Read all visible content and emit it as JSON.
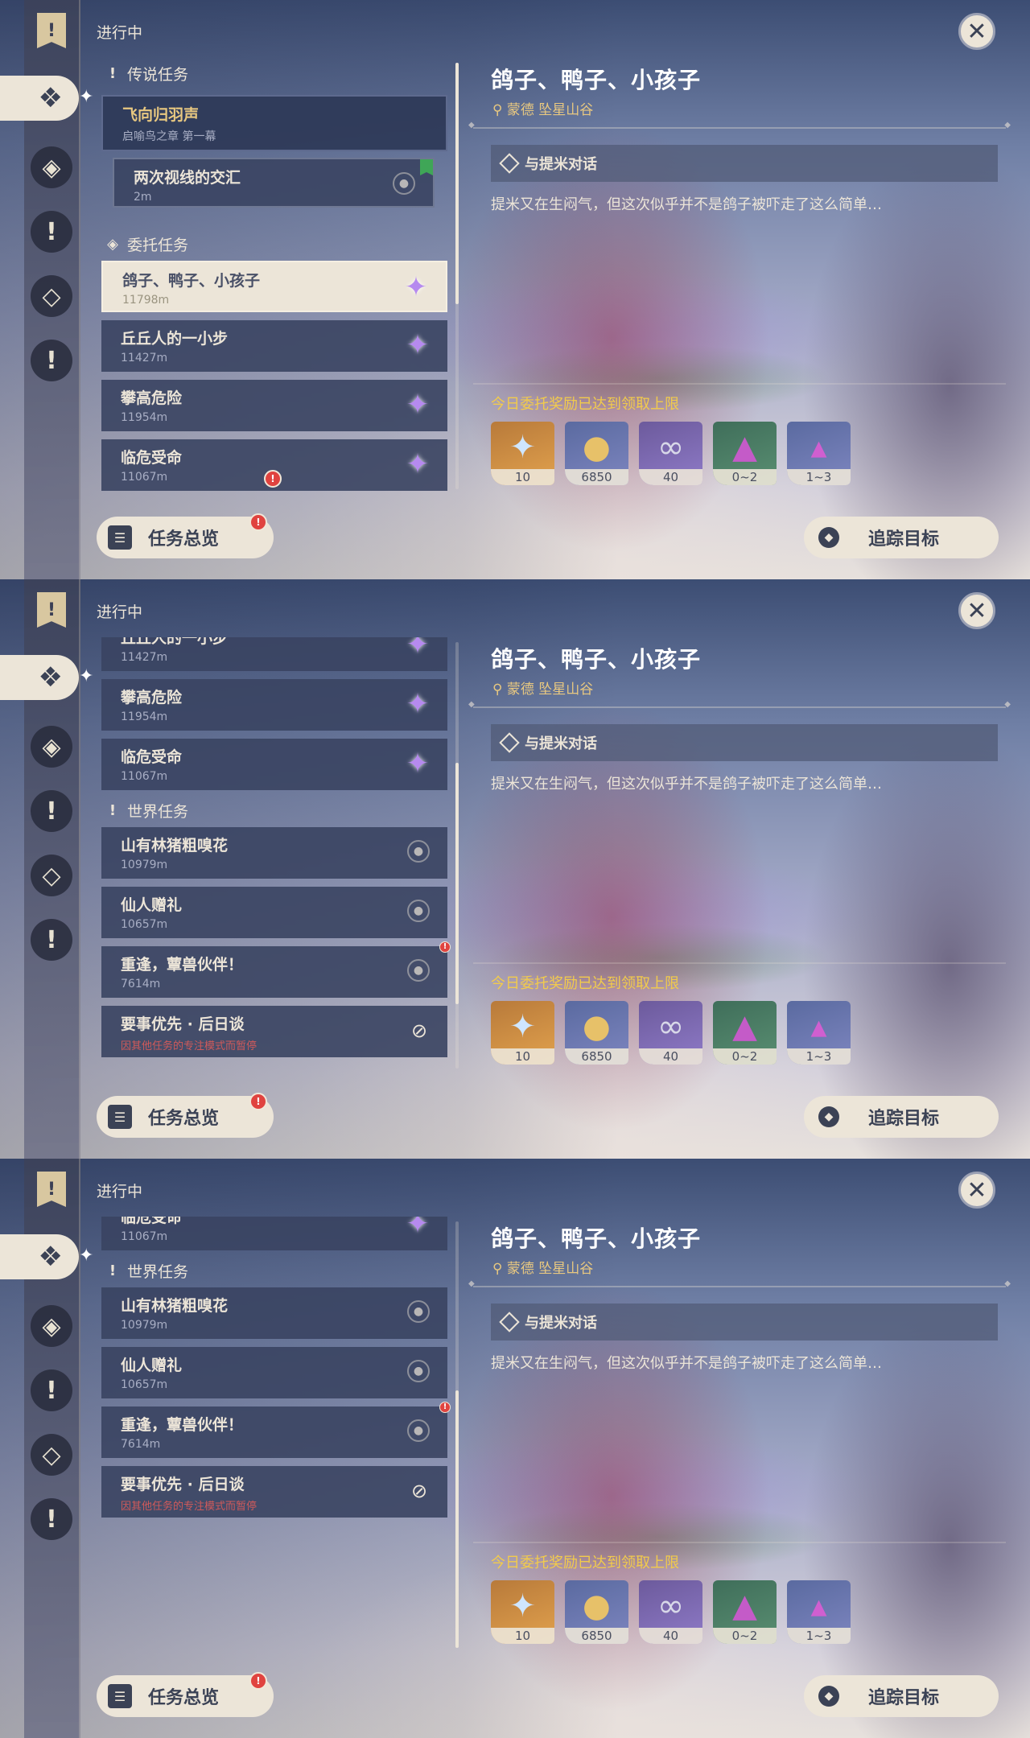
{
  "panels": [
    {
      "status_title": "进行中",
      "sections": [
        {
          "header": "传说任务",
          "header_icon": "exclamation-icon"
        },
        {
          "header": "委托任务",
          "header_icon": "commission-icon"
        }
      ],
      "quests": [
        {
          "title": "飞向归羽声",
          "subtitle": "启喻鸟之章 第一幕",
          "kind": "archon"
        },
        {
          "title": "两次视线的交汇",
          "subtitle": "2m",
          "kind": "sub"
        },
        {
          "title": "鸽子、鸭子、小孩子",
          "subtitle": "11798m",
          "kind": "selected"
        },
        {
          "title": "丘丘人的一小步",
          "subtitle": "11427m",
          "kind": "daily"
        },
        {
          "title": "攀高危险",
          "subtitle": "11954m",
          "kind": "daily"
        },
        {
          "title": "临危受命",
          "subtitle": "11067m",
          "kind": "daily"
        }
      ]
    },
    {
      "status_title": "进行中",
      "sections": [
        {
          "header": "世界任务",
          "header_icon": "exclamation-icon"
        }
      ],
      "quests": [
        {
          "title": "丘丘人的一小步",
          "subtitle": "11427m",
          "kind": "daily"
        },
        {
          "title": "攀高危险",
          "subtitle": "11954m",
          "kind": "daily"
        },
        {
          "title": "临危受命",
          "subtitle": "11067m",
          "kind": "daily"
        },
        {
          "title": "山有林猪粗嗅花",
          "subtitle": "10979m",
          "kind": "world"
        },
        {
          "title": "仙人赠礼",
          "subtitle": "10657m",
          "kind": "world"
        },
        {
          "title": "重逢，蕈兽伙伴！",
          "subtitle": "7614m",
          "kind": "world"
        },
        {
          "title": "要事优先 · 后日谈",
          "subtitle": "因其他任务的专注模式而暂停",
          "kind": "blocked"
        }
      ]
    },
    {
      "status_title": "进行中",
      "sections": [
        {
          "header": "世界任务",
          "header_icon": "exclamation-icon"
        }
      ],
      "quests": [
        {
          "title": "临危受命",
          "subtitle": "11067m",
          "kind": "daily"
        },
        {
          "title": "山有林猪粗嗅花",
          "subtitle": "10979m",
          "kind": "world"
        },
        {
          "title": "仙人赠礼",
          "subtitle": "10657m",
          "kind": "world"
        },
        {
          "title": "重逢，蕈兽伙伴！",
          "subtitle": "7614m",
          "kind": "world"
        },
        {
          "title": "要事优先 · 后日谈",
          "subtitle": "因其他任务的专注模式而暂停",
          "kind": "blocked"
        }
      ]
    }
  ],
  "detail": {
    "title": "鸽子、鸭子、小孩子",
    "location": "蒙德 坠星山谷",
    "objective": "与提米对话",
    "description": "提米又在生闷气，但这次似乎并不是鸽子被吓走了这么简单…",
    "reward_title": "今日委托奖励已达到领取上限",
    "rewards": [
      {
        "icon": "primogem-icon",
        "count": "10",
        "rarity": "gold"
      },
      {
        "icon": "mora-icon",
        "count": "6850",
        "rarity": "blue"
      },
      {
        "icon": "adventure-exp-icon",
        "count": "40",
        "rarity": "purple"
      },
      {
        "icon": "crystal-ore-icon",
        "count": "0~2",
        "rarity": "green"
      },
      {
        "icon": "crystal-chunk-icon",
        "count": "1~3",
        "rarity": "blue"
      }
    ]
  },
  "buttons": {
    "overview": "任务总览",
    "track": "追踪目标"
  },
  "badge_mark": "!"
}
